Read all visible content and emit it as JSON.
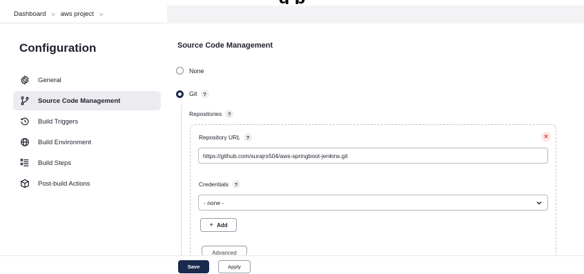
{
  "heading_cut": "g  p",
  "breadcrumb": {
    "items": [
      "Dashboard",
      "aws project"
    ],
    "separator": ">"
  },
  "sidebar": {
    "title": "Configuration",
    "items": [
      {
        "label": "General",
        "icon": "gear-icon",
        "active": false
      },
      {
        "label": "Source Code Management",
        "icon": "git-branch-icon",
        "active": true
      },
      {
        "label": "Build Triggers",
        "icon": "clock-icon",
        "active": false
      },
      {
        "label": "Build Environment",
        "icon": "globe-icon",
        "active": false
      },
      {
        "label": "Build Steps",
        "icon": "list-icon",
        "active": false
      },
      {
        "label": "Post-build Actions",
        "icon": "package-icon",
        "active": false
      }
    ]
  },
  "scm": {
    "title": "Source Code Management",
    "options": [
      {
        "label": "None",
        "checked": false
      },
      {
        "label": "Git",
        "checked": true
      }
    ],
    "help_glyph": "?",
    "repositories_label": "Repositories",
    "repository_url_label": "Repository URL",
    "repository_url_value": "https://github.com/surajrs504/aws-springboot-jenkins.git",
    "remove_glyph": "×",
    "credentials_label": "Credentials",
    "credentials_value": "- none -",
    "add_label": "Add",
    "add_glyph": "+",
    "advanced_label": "Advanced"
  },
  "footer": {
    "save_label": "Save",
    "apply_label": "Apply"
  },
  "colors": {
    "primary": "#1a2a4d",
    "danger": "#d73838"
  }
}
